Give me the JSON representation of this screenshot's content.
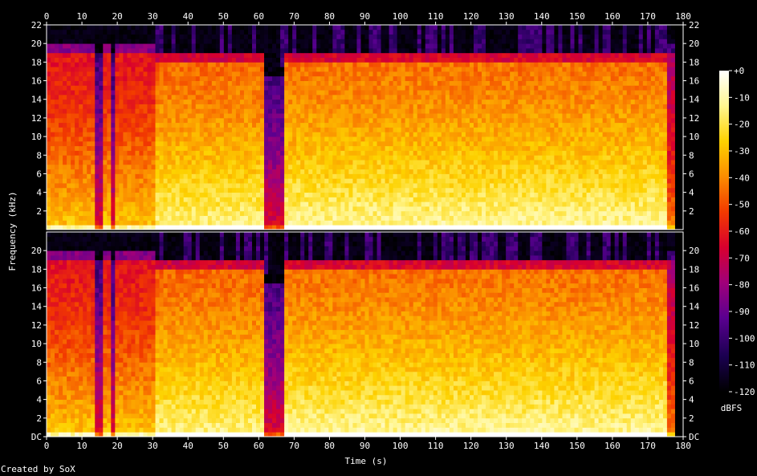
{
  "chart_data": {
    "type": "heatmap",
    "title": "",
    "xlabel": "Time (s)",
    "ylabel": "Frequency (kHz)",
    "xlim": [
      0,
      180
    ],
    "ylim_khz": [
      0,
      22
    ],
    "x_ticks": [
      "0",
      "10",
      "20",
      "30",
      "40",
      "50",
      "60",
      "70",
      "80",
      "90",
      "100",
      "110",
      "120",
      "130",
      "140",
      "150",
      "160",
      "170",
      "180"
    ],
    "y_ticks_top": [
      "22",
      "20",
      "18",
      "16",
      "14",
      "12",
      "10",
      "8",
      "6",
      "4",
      "2"
    ],
    "y_ticks_bottom": [
      "DC",
      "2",
      "4",
      "6",
      "8",
      "10",
      "12",
      "14",
      "16",
      "18",
      "20",
      "22"
    ],
    "channels": 2,
    "colorbar": {
      "label": "dBFS",
      "range": [
        -120,
        0
      ],
      "ticks": [
        "+0",
        "-10",
        "-20",
        "-30",
        "-40",
        "-50",
        "-60",
        "-70",
        "-80",
        "-90",
        "-100",
        "-110",
        "-120"
      ],
      "colors": [
        "#000000",
        "#1a0050",
        "#5a0090",
        "#a0007a",
        "#d8002e",
        "#f23a00",
        "#fb8c00",
        "#fdd200",
        "#fff690",
        "#ffffff"
      ]
    },
    "segments_seconds": [
      {
        "start": 0,
        "end": 31,
        "description": "lower energy, content to ~20 kHz with gaps near 15 s and 19 s"
      },
      {
        "start": 31,
        "end": 62,
        "description": "loud, dense broadband"
      },
      {
        "start": 62,
        "end": 67,
        "description": "quiet / near-silence"
      },
      {
        "start": 67,
        "end": 176,
        "description": "loud, dense broadband with high-frequency spikes"
      },
      {
        "start": 176,
        "end": 178,
        "description": "fade out"
      }
    ],
    "credit": "Created by SoX"
  }
}
